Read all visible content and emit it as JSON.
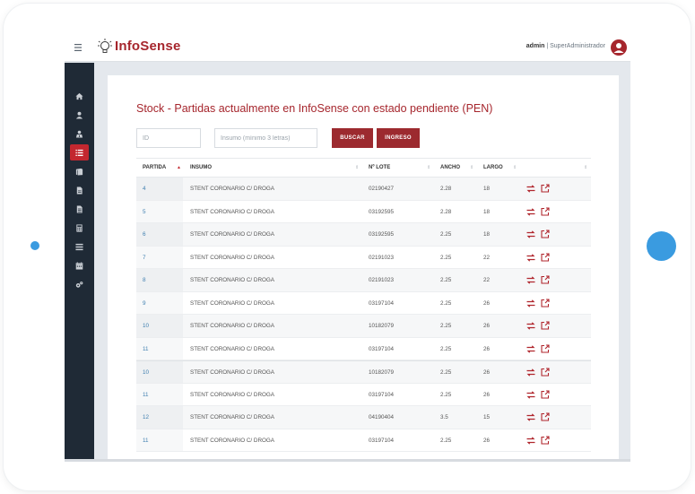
{
  "header": {
    "app_name": "InfoSense",
    "user_name": "admin",
    "user_role": "SuperAdministrador",
    "brand_color": "#a6262d"
  },
  "sidebar": {
    "items": [
      {
        "icon": "home-icon"
      },
      {
        "icon": "user-icon"
      },
      {
        "icon": "user-tie-icon"
      },
      {
        "icon": "list-icon",
        "active": true
      },
      {
        "icon": "book-icon"
      },
      {
        "icon": "file-icon"
      },
      {
        "icon": "file-alt-icon"
      },
      {
        "icon": "calculator-icon"
      },
      {
        "icon": "list-ul-icon"
      },
      {
        "icon": "calendar-icon"
      },
      {
        "icon": "cogs-icon"
      }
    ]
  },
  "page": {
    "title": "Stock - Partidas actualmente en InfoSense con estado pendiente (PEN)"
  },
  "filters": {
    "id_placeholder": "ID",
    "insumo_placeholder": "Insumo (mínimo 3 letras)",
    "buscar_label": "BUSCAR",
    "ingreso_label": "INGRESO"
  },
  "table": {
    "headers": {
      "partida": "PARTIDA",
      "insumo": "INSUMO",
      "lote": "Nº LOTE",
      "ancho": "ANCHO",
      "largo": "LARGO"
    },
    "rows": [
      {
        "partida": "4",
        "insumo": "STENT CORONARIO C/ DROGA",
        "lote": "02190427",
        "ancho": "2.28",
        "largo": "18"
      },
      {
        "partida": "5",
        "insumo": "STENT CORONARIO C/ DROGA",
        "lote": "03192595",
        "ancho": "2.28",
        "largo": "18"
      },
      {
        "partida": "6",
        "insumo": "STENT CORONARIO C/ DROGA",
        "lote": "03192595",
        "ancho": "2.25",
        "largo": "18"
      },
      {
        "partida": "7",
        "insumo": "STENT CORONARIO C/ DROGA",
        "lote": "02191023",
        "ancho": "2.25",
        "largo": "22"
      },
      {
        "partida": "8",
        "insumo": "STENT CORONARIO C/ DROGA",
        "lote": "02191023",
        "ancho": "2.25",
        "largo": "22"
      },
      {
        "partida": "9",
        "insumo": "STENT CORONARIO C/ DROGA",
        "lote": "03197104",
        "ancho": "2.25",
        "largo": "26"
      },
      {
        "partida": "10",
        "insumo": "STENT CORONARIO C/ DROGA",
        "lote": "10182079",
        "ancho": "2.25",
        "largo": "26"
      },
      {
        "partida": "11",
        "insumo": "STENT CORONARIO C/ DROGA",
        "lote": "03197104",
        "ancho": "2.25",
        "largo": "26"
      },
      {
        "partida": "10",
        "insumo": "STENT CORONARIO C/ DROGA",
        "lote": "10182079",
        "ancho": "2.25",
        "largo": "26"
      },
      {
        "partida": "11",
        "insumo": "STENT CORONARIO C/ DROGA",
        "lote": "03197104",
        "ancho": "2.25",
        "largo": "26"
      },
      {
        "partida": "12",
        "insumo": "STENT CORONARIO C/ DROGA",
        "lote": "04190404",
        "ancho": "3.5",
        "largo": "15"
      },
      {
        "partida": "11",
        "insumo": "STENT CORONARIO C/ DROGA",
        "lote": "03197104",
        "ancho": "2.25",
        "largo": "26"
      }
    ]
  },
  "colors": {
    "accent": "#a6262d",
    "sidebar_bg": "#1f2a36",
    "device_dot": "#3a9be0"
  }
}
